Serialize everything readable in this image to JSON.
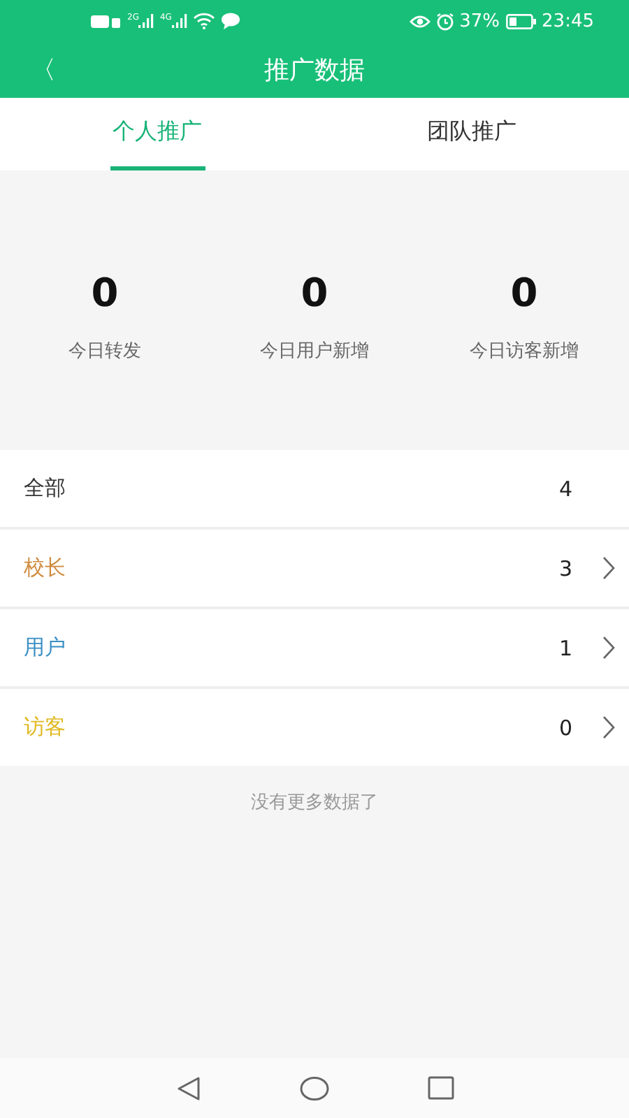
{
  "status_bar": {
    "networks": [
      "2G",
      "4G"
    ],
    "battery_text": "37%",
    "time": "23:45"
  },
  "header": {
    "back": "〈",
    "title": "推广数据"
  },
  "tabs": [
    {
      "label": "个人推广",
      "selected": true
    },
    {
      "label": "团队推广",
      "selected": false
    }
  ],
  "stats": [
    {
      "value": "0",
      "label": "今日转发"
    },
    {
      "value": "0",
      "label": "今日用户新增"
    },
    {
      "value": "0",
      "label": "今日访客新增"
    }
  ],
  "rows": [
    {
      "label": "全部",
      "count": "4",
      "color": "#333333",
      "has_arrow": false
    },
    {
      "label": "校长",
      "count": "3",
      "color": "#d08a3c",
      "has_arrow": true
    },
    {
      "label": "用户",
      "count": "1",
      "color": "#3a8fc4",
      "has_arrow": true
    },
    {
      "label": "访客",
      "count": "0",
      "color": "#e0b820",
      "has_arrow": true
    }
  ],
  "footer": "没有更多数据了"
}
